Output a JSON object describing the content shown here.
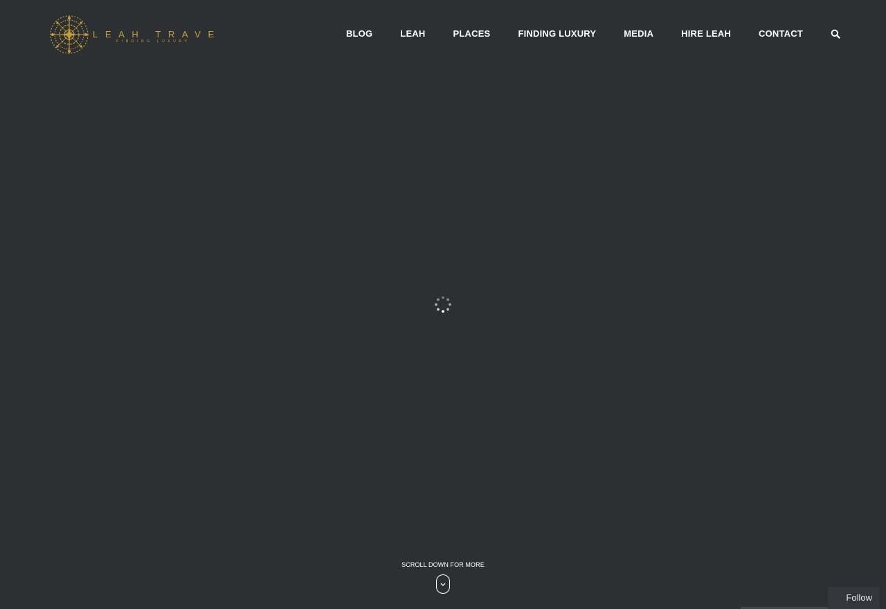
{
  "header": {
    "logo": {
      "name": "LEAH TRAVELS",
      "tagline": "FINDING LUXURY",
      "color": "#c9a03a"
    },
    "nav": [
      {
        "label": "BLOG"
      },
      {
        "label": "LEAH"
      },
      {
        "label": "PLACES"
      },
      {
        "label": "FINDING LUXURY"
      },
      {
        "label": "MEDIA"
      },
      {
        "label": "HIRE LEAH"
      },
      {
        "label": "CONTACT"
      }
    ],
    "search_icon": "search-icon"
  },
  "main": {
    "loading_icon": "loading-spinner-icon",
    "scroll_hint": "SCROLL DOWN FOR MORE",
    "scroll_icon": "chevron-down-icon"
  },
  "follow_button": {
    "label": "Follow"
  },
  "colors": {
    "background": "#2d3033",
    "nav_text": "#ffffff",
    "accent_gold": "#c9a03a"
  }
}
